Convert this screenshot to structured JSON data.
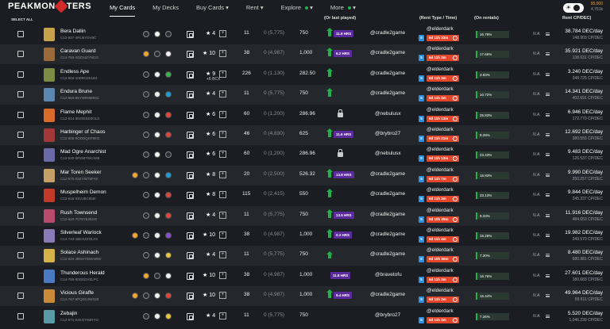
{
  "logo": {
    "text_left": "PEAKMON",
    "text_right": "TERS"
  },
  "nav": [
    {
      "label": "My Cards",
      "active": true
    },
    {
      "label": "My Decks"
    },
    {
      "label": "Buy Cards"
    },
    {
      "label": "Rent"
    },
    {
      "label": "Explore"
    },
    {
      "label": "More"
    }
  ],
  "balance": {
    "primary": "95,000",
    "secondary": "4,751k"
  },
  "header": {
    "select_all": "SELECT ALL",
    "last_played": "(Or last played)",
    "rent_type": "(Rent Type / Time)",
    "on_rentals": "(On rentals)",
    "rent_cpdec": "Rent CP/DEC)"
  },
  "rows": [
    {
      "name": "Bera Dallin",
      "uid": "C12-627-4RU6YDV8C",
      "thumb": "#c7a24a",
      "elems": [
        "d",
        "w",
        "d"
      ],
      "stars": "4",
      "level": "11",
      "bcx": "0 (5,775)",
      "cp": "750",
      "status": {
        "kind": "hrs",
        "text": "11.8 HRS"
      },
      "player": "@cradle2game",
      "renter": "@elderdark",
      "time": "6d 11h 33m",
      "pct": "16.79%",
      "na": "N.A.",
      "cp_dec": "38.784 DEC/day",
      "cp_total": "148.903 CP/DEC"
    },
    {
      "name": "Caravan Guard",
      "uid": "C14-753-S3Z34ZYNGG",
      "thumb": "#9a6a3a",
      "elems": [
        "o",
        "d",
        "w"
      ],
      "stars": "10",
      "level": "38",
      "bcx": "0 (4,987)",
      "cp": "1,000",
      "status": {
        "kind": "hrs",
        "text": "6.2 HRS"
      },
      "player": "@cradle2game",
      "renter": "@elderdark",
      "time": "6d 11h 3m",
      "pct": "17.66%",
      "na": "N.A.",
      "cp_dec": "35.921 DEC/day",
      "cp_total": "138.631 CP/DEC"
    },
    {
      "name": "Endless Ape",
      "uid": "C12-563-10D9O2E1B4",
      "thumb": "#7e8a44",
      "elems": [
        "d",
        "w",
        "g"
      ],
      "stars": "9",
      "extra": "+6 BCX",
      "level": "226",
      "bcx": "0 (1,130)",
      "cp": "282.50",
      "status": {
        "kind": "up"
      },
      "player": "@cradle2game",
      "renter": "@elderdark",
      "time": "6d 11h 3m",
      "pct": "3.93%",
      "na": "N.A.",
      "cp_dec": "3.240 DEC/day",
      "cp_total": "348.725 CP/DEC"
    },
    {
      "name": "Endura Brune",
      "uid": "C12-583-85YWR8M9SC",
      "thumb": "#5a86b0",
      "elems": [
        "d",
        "w",
        "b"
      ],
      "stars": "4",
      "level": "11",
      "bcx": "0 (5,775)",
      "cp": "750",
      "status": {
        "kind": "up"
      },
      "player": "@cradle2game",
      "renter": "@elderdark",
      "time": "6d 11h 3m",
      "pct": "10.72%",
      "na": "N.A.",
      "cp_dec": "14.341 DEC/day",
      "cp_total": "402.691 CP/DEC"
    },
    {
      "name": "Flame Mephit",
      "uid": "C12-614-3NGGSD3OLS",
      "thumb": "#d86a2a",
      "elems": [
        "d",
        "w",
        "r"
      ],
      "stars": "6",
      "level": "60",
      "bcx": "0 (1,200)",
      "cp": "286.96",
      "status": {
        "kind": "lock"
      },
      "player": "@nebulusx",
      "renter": "@elderdark",
      "time": "6d 11h 13m",
      "pct": "25.83%",
      "na": "N.A.",
      "cp_dec": "6.946 DEC/day",
      "cp_total": "172.770 CP/DEC"
    },
    {
      "name": "Harbinger of Chaos",
      "uid": "C12-605-0ODDQKF9KG",
      "thumb": "#a23838",
      "elems": [
        "d",
        "w",
        "r"
      ],
      "stars": "6",
      "level": "46",
      "bcx": "0 (4,830)",
      "cp": "625",
      "status": {
        "kind": "hrs",
        "text": "11.6 HRS"
      },
      "player": "@brybro27",
      "renter": "@elderdark",
      "time": "6d 11h 21m",
      "pct": "8.28%",
      "na": "N.A.",
      "cp_dec": "12.692 DEC/day",
      "cp_total": "380.555 CP/DEC"
    },
    {
      "name": "Mad Ogre Anarchist",
      "uid": "C12-630-0RSM7WCX68",
      "thumb": "#6a6aa6",
      "elems": [
        "d",
        "w",
        "d"
      ],
      "stars": "6",
      "level": "60",
      "bcx": "0 (1,200)",
      "cp": "286.96",
      "status": {
        "kind": "lock"
      },
      "player": "@nebulusx",
      "renter": "@elderdark",
      "time": "6d 11h 13m",
      "pct": "23.43%",
      "na": "N.A.",
      "cp_dec": "9.483 DEC/day",
      "cp_total": "126.537 CP/DEC"
    },
    {
      "name": "Mar Toren Seeker",
      "uid": "C12-575-01EYW75FA8",
      "thumb": "#c4a066",
      "elems": [
        "o",
        "d",
        "w",
        "b"
      ],
      "stars": "8",
      "level": "20",
      "bcx": "0 (2,500)",
      "cp": "526.32",
      "status": {
        "kind": "hrs",
        "text": "13.8 HRS"
      },
      "player": "@cradle2game",
      "renter": "@elderdark",
      "time": "6d 11h 7m",
      "pct": "16.83%",
      "na": "N.A.",
      "cp_dec": "9.990 DEC/day",
      "cp_total": "250.257 CP/DEC"
    },
    {
      "name": "Muspelheim Demon",
      "uid": "C12-616-0SVJBC858I",
      "thumb": "#c23a2a",
      "elems": [
        "d",
        "w",
        "r"
      ],
      "stars": "8",
      "level": "115",
      "bcx": "0 (2,415)",
      "cp": "550",
      "status": {
        "kind": "up"
      },
      "player": "@cradle2game",
      "renter": "@elderdark",
      "time": "6d 11h 3m",
      "pct": "33.13%",
      "na": "N.A.",
      "cp_dec": "9.844 DEC/day",
      "cp_total": "245.337 CP/DEC"
    },
    {
      "name": "Rush Townsend",
      "uid": "C12-620-7079Y5JEDG",
      "thumb": "#b84a6a",
      "elems": [
        "d",
        "w",
        "r"
      ],
      "stars": "4",
      "level": "11",
      "bcx": "0 (5,775)",
      "cp": "750",
      "status": {
        "kind": "hrs",
        "text": "13.5 HRS"
      },
      "player": "@cradle2game",
      "renter": "@elderdark",
      "time": "6d 10h 09m",
      "pct": "9.33%",
      "na": "N.A.",
      "cp_dec": "11.916 DEC/day",
      "cp_total": "484.653 CP/DEC"
    },
    {
      "name": "Silverleaf Warlock",
      "uid": "C14-743-1BKXZZOLY8",
      "thumb": "#8a7ab6",
      "elems": [
        "o",
        "d",
        "w",
        "p"
      ],
      "stars": "10",
      "level": "38",
      "bcx": "0 (4,987)",
      "cp": "1,000",
      "status": {
        "kind": "hrs",
        "text": "0.2 HRS"
      },
      "player": "@cradle2game",
      "renter": "@elderdark",
      "time": "6d 11h 4m",
      "pct": "15.28%",
      "na": "N.A.",
      "cp_dec": "19.982 DEC/day",
      "cp_total": "249.570 CP/DEC"
    },
    {
      "name": "Solace Ashinach",
      "uid": "C12-624-J8GHYEMAWW",
      "thumb": "#d6b24a",
      "elems": [
        "d",
        "w",
        "y"
      ],
      "stars": "4",
      "level": "11",
      "bcx": "0 (5,775)",
      "cp": "750",
      "status": {
        "kind": "up_short"
      },
      "player": "@cradle2game",
      "renter": "@elderdark",
      "time": "6d 10h 56m",
      "pct": "7.20%",
      "na": "N.A.",
      "cp_dec": "8.480 DEC/day",
      "cp_total": "680.981 CP/DEC"
    },
    {
      "name": "Thunderous Herald",
      "uid": "C14-755-00GEDVZLPC",
      "thumb": "#4a7ac2",
      "elems": [
        "o",
        "d",
        "w"
      ],
      "stars": "10",
      "level": "38",
      "bcx": "0 (4,987)",
      "cp": "1,000",
      "status": {
        "kind": "hrs_only",
        "text": "11.8 HRS"
      },
      "player": "@bravetofu",
      "renter": "@elderdark",
      "time": "6d 11h 3m",
      "pct": "16.76%",
      "na": "N.A.",
      "cp_dec": "27.601 DEC/day",
      "cp_total": "180.683 CP/DEC"
    },
    {
      "name": "Vicious Giraffe",
      "uid": "C14-767-5PQSVJWX28",
      "thumb": "#c98a3a",
      "elems": [
        "o",
        "d",
        "w",
        "r"
      ],
      "stars": "10",
      "level": "38",
      "bcx": "0 (4,987)",
      "cp": "1,000",
      "status": {
        "kind": "hrs",
        "text": "9.4 HRS"
      },
      "player": "@cradle2game",
      "renter": "@elderdark",
      "time": "6d 11h 3m",
      "pct": "16.44%",
      "na": "N.A.",
      "cp_dec": "49.964 DEC/day",
      "cp_total": "99.611 CP/DEC"
    },
    {
      "name": "Zebajin",
      "uid": "C12-571-04KOY93RYO",
      "thumb": "#5a9aa6",
      "elems": [
        "d",
        "w",
        "y"
      ],
      "stars": "4",
      "level": "11",
      "bcx": "0 (5,775)",
      "cp": "750",
      "status": {
        "kind": "none"
      },
      "player": "@brybro27",
      "renter": "@elderdark",
      "time": "6d 11h 3m",
      "pct": "7.26%",
      "na": "N.A.",
      "cp_dec": "5.520 DEC/day",
      "cp_total": "1,046.239 CP/DEC"
    }
  ]
}
